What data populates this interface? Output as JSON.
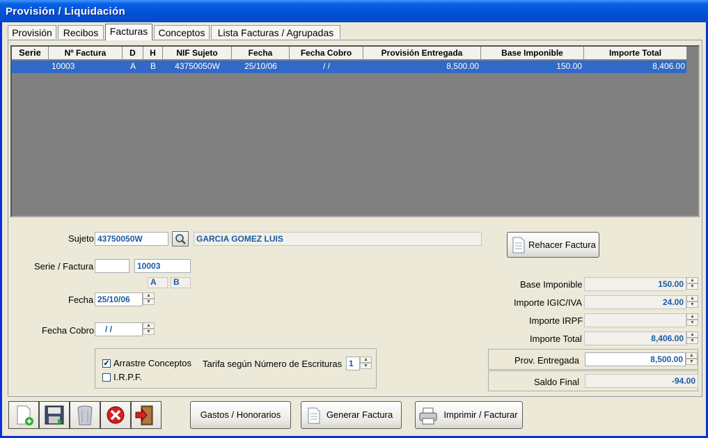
{
  "window": {
    "title": "Provisión / Liquidación"
  },
  "tabs": [
    {
      "label": "Provisión"
    },
    {
      "label": "Recibos"
    },
    {
      "label": "Facturas"
    },
    {
      "label": "Conceptos"
    },
    {
      "label": "Lista Facturas / Agrupadas"
    }
  ],
  "grid": {
    "columns": [
      "Serie",
      "Nº Factura",
      "D",
      "H",
      "NIF Sujeto",
      "Fecha",
      "Fecha Cobro",
      "Provisión Entregada",
      "Base Imponible",
      "Importe Total"
    ],
    "rows": [
      {
        "serie": "",
        "numero": "10003",
        "d": "A",
        "h": "B",
        "nif": "43750050W",
        "fecha": "25/10/06",
        "fecha_cobro": "/ /",
        "provision": "8,500.00",
        "base": "150.00",
        "total": "8,406.00"
      }
    ]
  },
  "form": {
    "sujeto_label": "Sujeto",
    "sujeto_value": "43750050W",
    "sujeto_name": "GARCIA GOMEZ LUIS",
    "serie_factura_label": "Serie / Factura",
    "serie_value": "",
    "factura_value": "10003",
    "d_value": "A",
    "h_value": "B",
    "fecha_label": "Fecha",
    "fecha_value": "25/10/06",
    "fecha_cobro_label": "Fecha Cobro",
    "fecha_cobro_value": "/ /",
    "arrastre_label": "Arrastre Conceptos",
    "arrastre_checked": true,
    "irpf_label": "I.R.P.F.",
    "irpf_checked": false,
    "tarifa_label": "Tarifa según Número de Escrituras",
    "tarifa_value": "1"
  },
  "totals": {
    "rehacer_label": "Rehacer Factura",
    "base_label": "Base Imponible",
    "base_value": "150.00",
    "igic_label": "Importe IGIC/IVA",
    "igic_value": "24.00",
    "irpf_label": "Importe IRPF",
    "irpf_value": "",
    "total_label": "Importe Total",
    "total_value": "8,406.00",
    "prov_label": "Prov. Entregada",
    "prov_value": "8,500.00",
    "saldo_label": "Saldo Final",
    "saldo_value": "-94.00"
  },
  "bottom": {
    "gastos_label": "Gastos / Honorarios",
    "generar_label": "Generar Factura",
    "imprimir_label": "Imprimir / Facturar"
  },
  "colors": {
    "titlebar": "#0051d8",
    "selection": "#3169c6",
    "value_text": "#1c5aa0"
  }
}
